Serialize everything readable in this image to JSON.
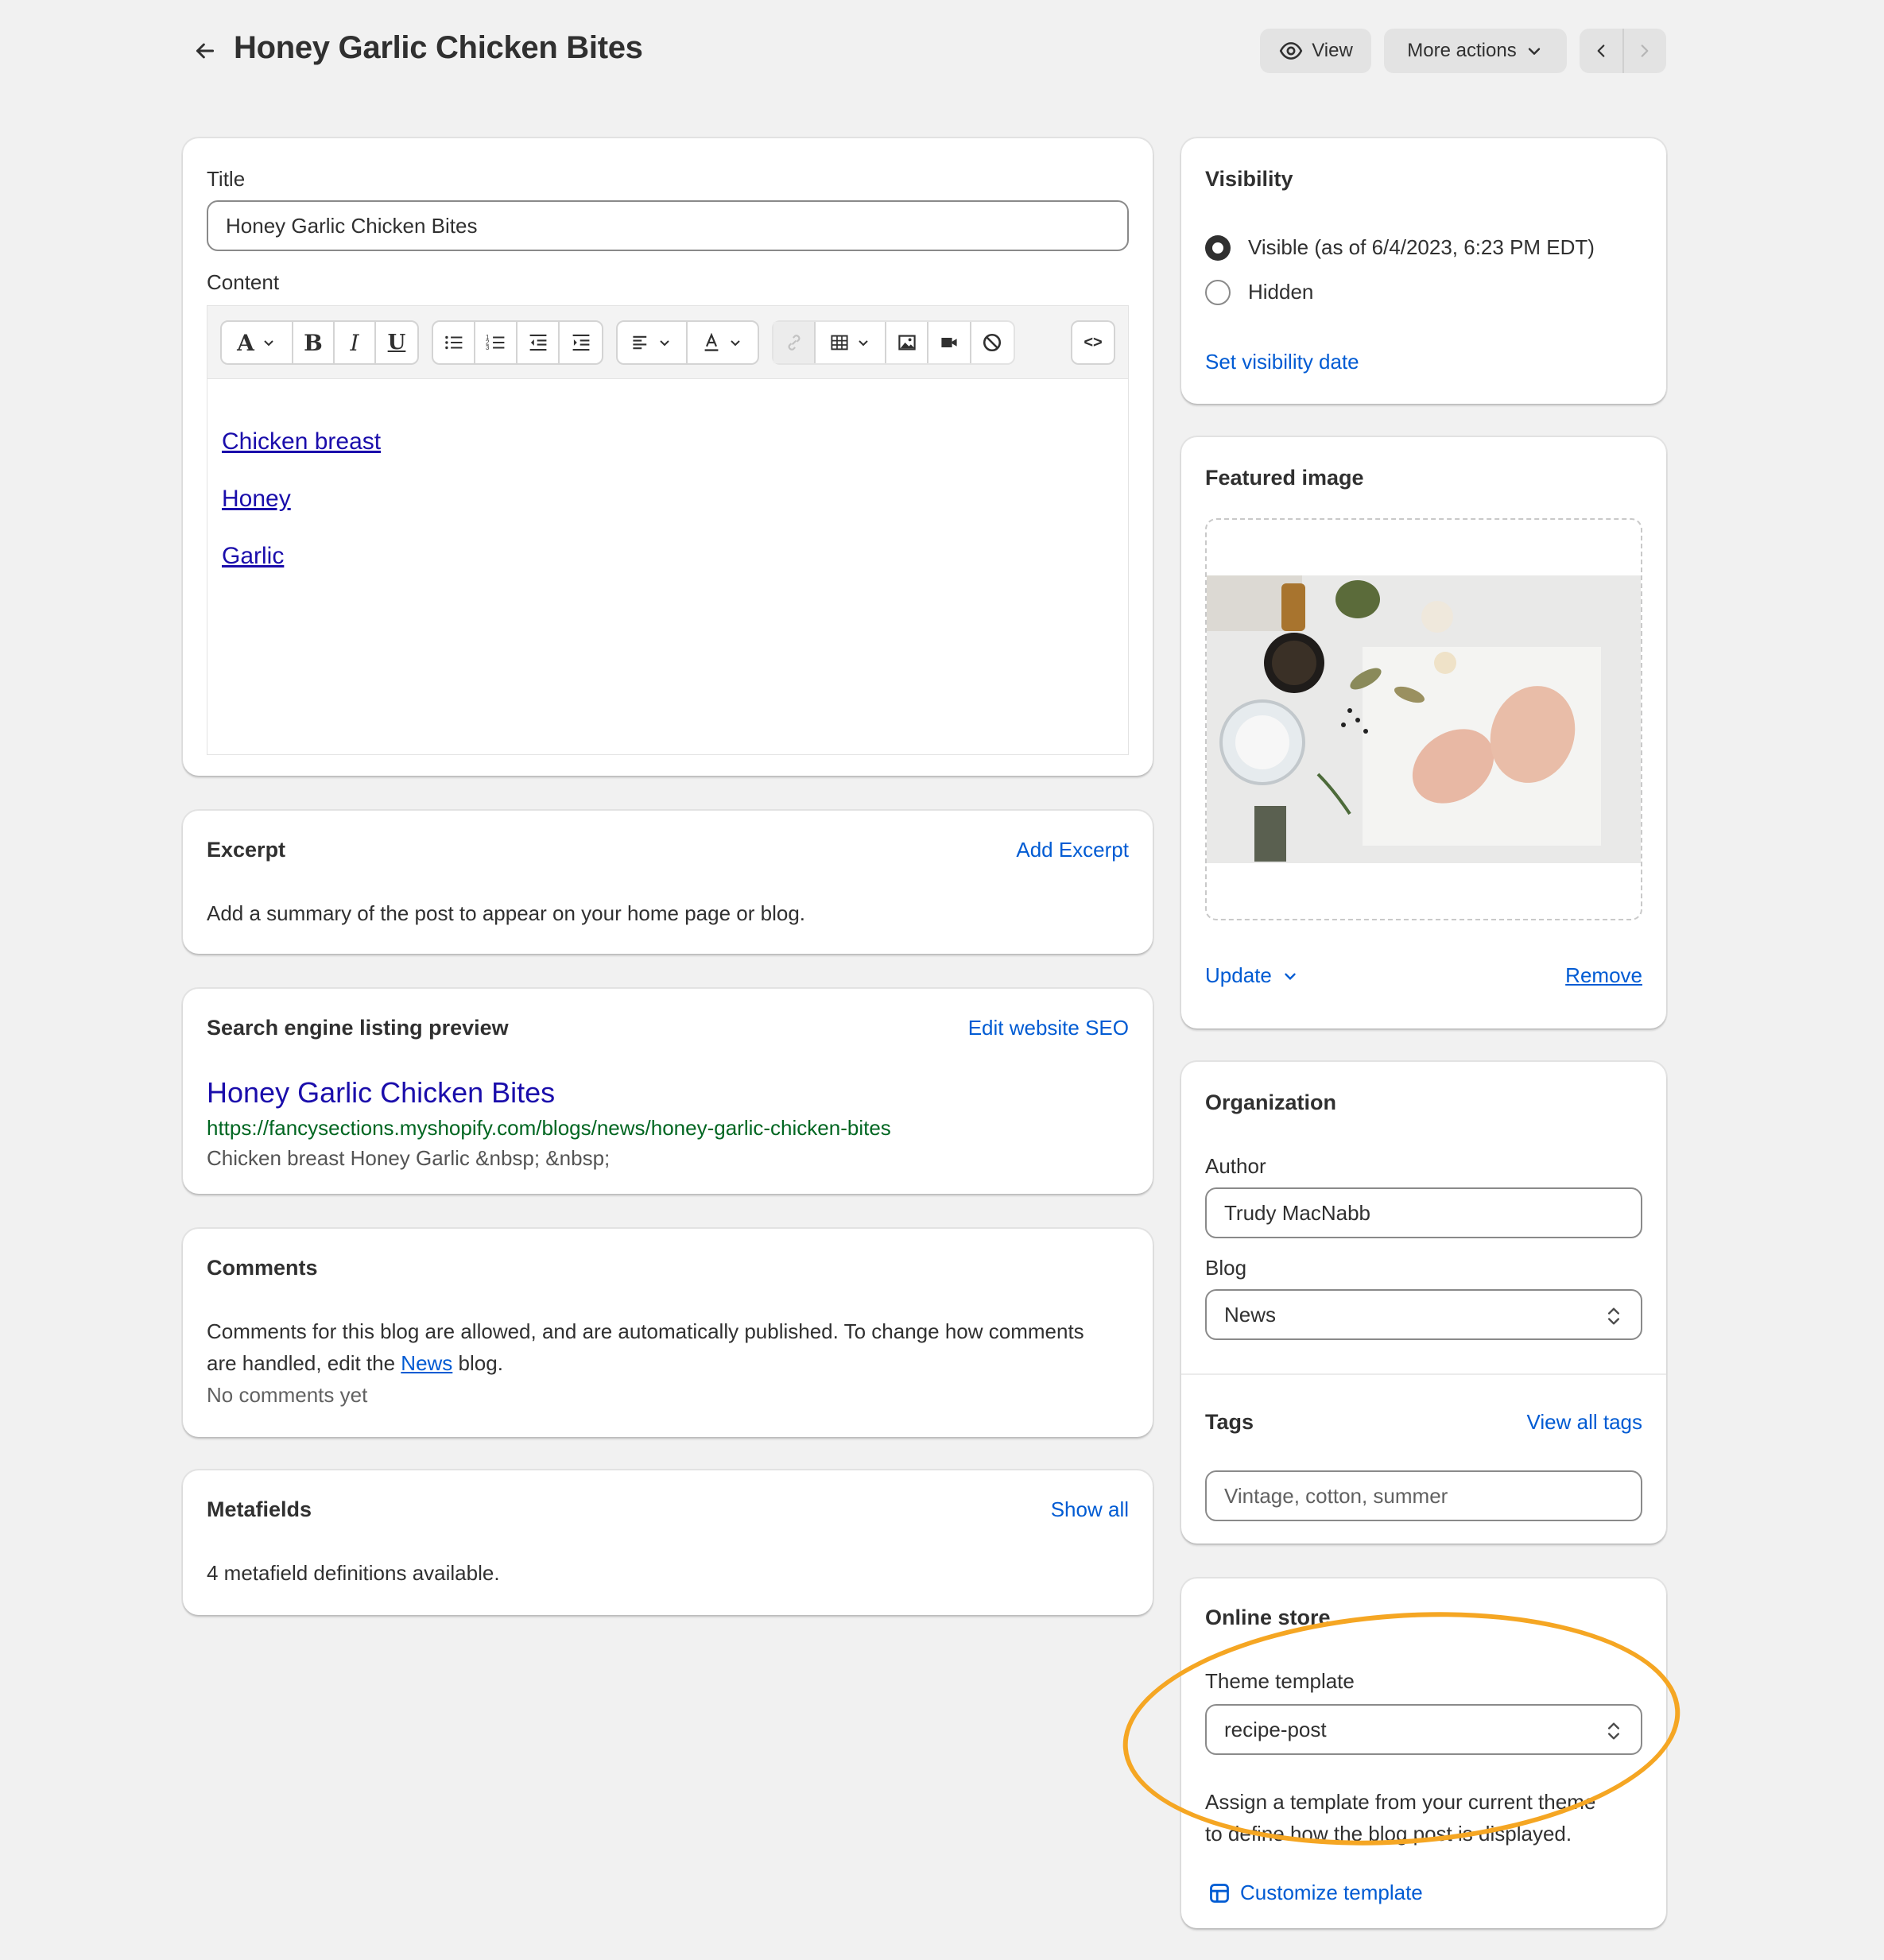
{
  "header": {
    "title": "Honey Garlic Chicken Bites",
    "view_label": "View",
    "more_actions_label": "More actions"
  },
  "editor_card": {
    "title_label": "Title",
    "title_value": "Honey Garlic Chicken Bites",
    "content_label": "Content",
    "toolbar": {
      "font_icon": "A",
      "bold": "B",
      "italic": "I",
      "underline": "U",
      "html_toggle": "<>"
    },
    "links": [
      "Chicken breast",
      "Honey",
      "Garlic"
    ]
  },
  "excerpt": {
    "heading": "Excerpt",
    "action": "Add Excerpt",
    "description": "Add a summary of the post to appear on your home page or blog."
  },
  "seo": {
    "heading": "Search engine listing preview",
    "action": "Edit website SEO",
    "preview_title": "Honey Garlic Chicken Bites",
    "preview_url": "https://fancysections.myshopify.com/blogs/news/honey-garlic-chicken-bites",
    "preview_description": "Chicken breast Honey Garlic &nbsp; &nbsp;"
  },
  "comments": {
    "heading": "Comments",
    "line1": "Comments for this blog are allowed, and are automatically published. To change how comments",
    "line2_prefix": "are handled, edit the ",
    "line2_link": "News",
    "line2_suffix": " blog.",
    "empty": "No comments yet"
  },
  "metafields": {
    "heading": "Metafields",
    "action": "Show all",
    "description": "4 metafield definitions available."
  },
  "visibility": {
    "heading": "Visibility",
    "visible_label": "Visible (as of 6/4/2023, 6:23 PM EDT)",
    "hidden_label": "Hidden",
    "selected": "visible",
    "set_date": "Set visibility date"
  },
  "featured_image": {
    "heading": "Featured image",
    "update": "Update",
    "remove": "Remove"
  },
  "organization": {
    "heading": "Organization",
    "author_label": "Author",
    "author_value": "Trudy MacNabb",
    "blog_label": "Blog",
    "blog_value": "News",
    "tags_heading": "Tags",
    "tags_action": "View all tags",
    "tags_placeholder": "Vintage, cotton, summer"
  },
  "online_store": {
    "heading": "Online store",
    "template_label": "Theme template",
    "template_value": "recipe-post",
    "help_line1": "Assign a template from your current theme",
    "help_line2": "to define how the blog post is displayed.",
    "customize": "Customize template"
  },
  "colors": {
    "link": "#005bd3",
    "seo_title": "#1a0dab",
    "seo_url": "#006621",
    "annotation": "#f5a623",
    "background": "#f1f1f1"
  }
}
